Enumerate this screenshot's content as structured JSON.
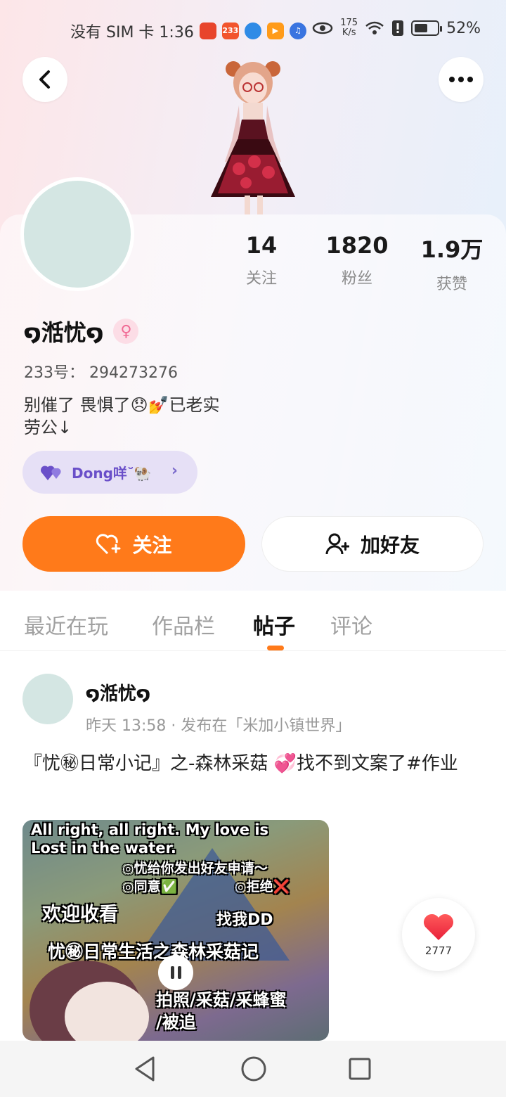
{
  "status_bar": {
    "carrier_time": "没有 SIM 卡 1:36",
    "net_speed_value": "175",
    "net_speed_unit": "K/s",
    "battery": "52%",
    "app_icons": [
      "app-icon-red",
      "app-icon-233",
      "app-icon-blue",
      "app-icon-orange-play",
      "app-icon-music"
    ]
  },
  "header": {
    "back_icon": "chevron-left-icon",
    "more_icon": "more-dots-icon"
  },
  "profile": {
    "stats": [
      {
        "value": "14",
        "label": "关注"
      },
      {
        "value": "1820",
        "label": "粉丝"
      },
      {
        "value": "1.9万",
        "label": "获赞"
      }
    ],
    "username": "໑湉忧໑",
    "gender_symbol": "♀",
    "uid": "233号： 294273276",
    "bio_line1": "别催了 畏惧了😞💅已老实",
    "bio_line2": "劳公↓",
    "tag_text": "Dong咩˘🐏",
    "follow_label": "关注",
    "add_friend_label": "加好友"
  },
  "tabs": [
    {
      "label": "最近在玩",
      "active": false
    },
    {
      "label": "作品栏",
      "active": false
    },
    {
      "label": "帖子",
      "active": true
    },
    {
      "label": "评论",
      "active": false
    }
  ],
  "post": {
    "username": "໑湉忧໑",
    "meta": "昨天 13:58 · 发布在「米加小镇世界」",
    "text": "『忧㊙日常小记』之-森林采菇 💞找不到文案了#作业",
    "video_lines": [
      "All right, all right. My love is",
      "Lost in the water.",
      "◎忧给你发出好友申请～",
      "◎同意✅",
      "◎拒绝❌",
      "欢迎收看",
      "找我DD",
      "忧㊙日常生活之森林采菇记",
      "拍照/采菇/采蜂蜜",
      "/被追"
    ],
    "like_count": "2777"
  },
  "colors": {
    "accent": "#ff7a1a",
    "tag_bg": "#e6e0f6",
    "tag_text": "#6a4fc9",
    "avatar_bg": "#d4e6e3"
  }
}
